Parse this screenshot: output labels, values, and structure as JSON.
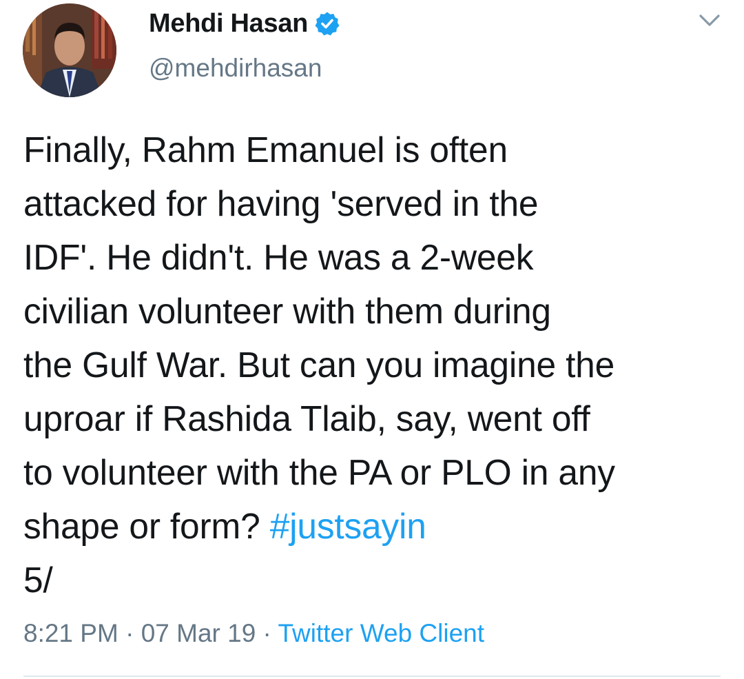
{
  "author": {
    "display_name": "Mehdi Hasan",
    "handle": "@mehdirhasan",
    "verified": true,
    "avatar_icon": "profile-photo"
  },
  "menu_icon": "chevron-down-icon",
  "tweet": {
    "lines": [
      "Finally, Rahm Emanuel is often",
      "attacked for having 'served in the",
      "IDF'. He didn't. He was a 2-week",
      "civilian volunteer with them during",
      "the Gulf War. But can you imagine the",
      "uproar if Rashida Tlaib, say, went off",
      "to volunteer with the PA or PLO in any"
    ],
    "last_line_text": "shape or form? ",
    "hashtag": "#justsayin",
    "thread_marker": "5/"
  },
  "meta": {
    "time": "8:21 PM",
    "separator": " · ",
    "date": "07 Mar 19",
    "client": "Twitter Web Client"
  },
  "colors": {
    "link": "#1da1f2",
    "text": "#14171a",
    "secondary": "#657786",
    "verified_badge": "#1da1f2"
  }
}
